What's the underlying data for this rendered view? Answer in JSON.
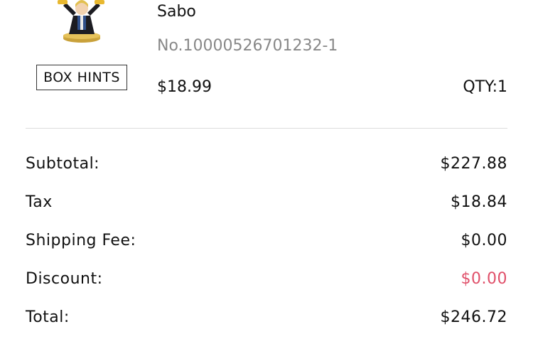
{
  "product": {
    "name": "Sabo",
    "number": "No.10000526701232-1",
    "price": "$18.99",
    "qty": "QTY:1",
    "box_hints_label": "BOX HINTS",
    "image_icon": "figure-thumbnail-icon"
  },
  "summary": {
    "subtotal": {
      "label": "Subtotal:",
      "value": "$227.88"
    },
    "tax": {
      "label": "Tax",
      "value": "$18.84"
    },
    "shipping": {
      "label": "Shipping Fee:",
      "value": "$0.00"
    },
    "discount": {
      "label": "Discount:",
      "value": "$0.00"
    },
    "total": {
      "label": "Total:",
      "value": "$246.72"
    }
  },
  "colors": {
    "text_primary": "#111111",
    "text_secondary": "#888888",
    "discount": "#e0506a",
    "divider": "#dcdcdc"
  }
}
